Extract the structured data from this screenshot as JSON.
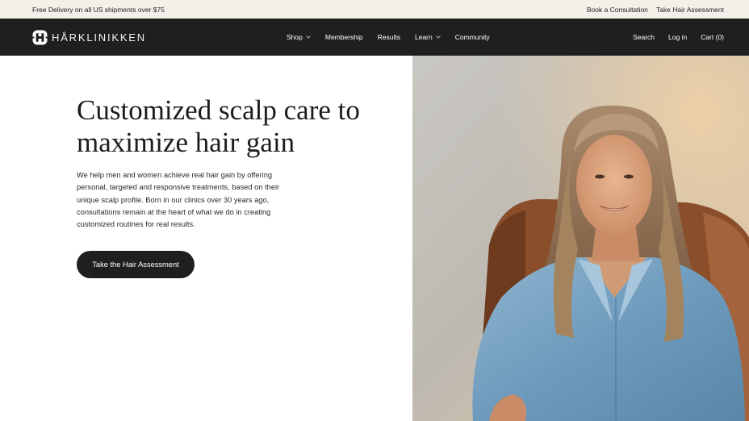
{
  "announcement": {
    "text": "Free Delivery on all US shipments over $75",
    "links": [
      "Book a Consultation",
      "Take Hair Assessment"
    ]
  },
  "header": {
    "brand": "HÅRKLINIKKEN",
    "nav": [
      {
        "label": "Shop",
        "dropdown": true
      },
      {
        "label": "Membership",
        "dropdown": false
      },
      {
        "label": "Results",
        "dropdown": false
      },
      {
        "label": "Learn",
        "dropdown": true
      },
      {
        "label": "Community",
        "dropdown": false
      }
    ],
    "actions": {
      "search": "Search",
      "login": "Log in",
      "cart": "Cart (0)"
    }
  },
  "hero": {
    "title": "Customized scalp care to maximize hair gain",
    "body": "We help men and women achieve real hair gain by offering personal, targeted and responsive treatments, based on their unique scalp profile. Born in our clinics over 30 years ago, consultations remain at the heart of what we do in creating customized routines for real results.",
    "cta": "Take the Hair Assessment"
  },
  "colors": {
    "announcement_bg": "#f4efe9",
    "nav_bg": "#1f1f1f",
    "cta_bg": "#1f1f1f"
  }
}
